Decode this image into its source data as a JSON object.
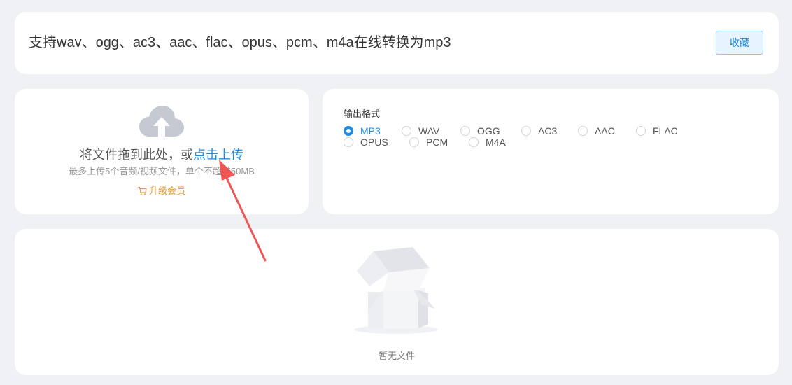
{
  "header": {
    "title": "支持wav、ogg、ac3、aac、flac、opus、pcm、m4a在线转换为mp3",
    "favorite_label": "收藏"
  },
  "upload": {
    "icon": "cloud-upload-icon",
    "prompt_text": "将文件拖到此处，或",
    "prompt_link": "点击上传",
    "limit_text": "最多上传5个音频/视频文件，单个不超过50MB",
    "upgrade_icon": "cart-icon",
    "upgrade_label": "升级会员",
    "accent_color": "#1f8ce3",
    "upgrade_color": "#e39b29"
  },
  "format": {
    "label": "输出格式",
    "selected": "MP3",
    "options": [
      "MP3",
      "WAV",
      "OGG",
      "AC3",
      "AAC",
      "FLAC",
      "OPUS",
      "PCM",
      "M4A"
    ]
  },
  "files": {
    "illustration": "empty-box-illustration",
    "empty_text": "暂无文件"
  },
  "annotation": {
    "icon": "red-arrow-pointer",
    "color": "#f05555"
  }
}
